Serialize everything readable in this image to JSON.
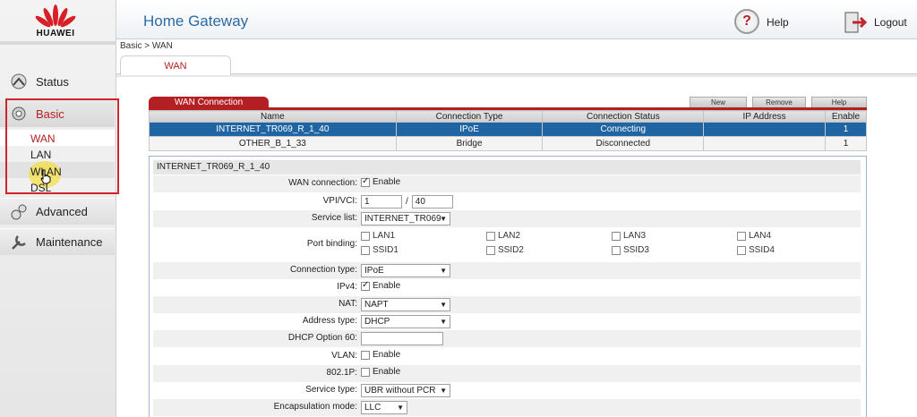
{
  "brand": {
    "name": "HUAWEI",
    "color": "#b41f24"
  },
  "header": {
    "title": "Home Gateway",
    "help_label": "Help",
    "logout_label": "Logout"
  },
  "breadcrumb": "Basic > WAN",
  "tab": {
    "label": "WAN"
  },
  "sidebar": {
    "items": [
      {
        "label": "Status",
        "icon": "status-icon"
      },
      {
        "label": "Basic",
        "icon": "basic-icon"
      },
      {
        "label": "Advanced",
        "icon": "advanced-icon"
      },
      {
        "label": "Maintenance",
        "icon": "maintenance-icon"
      }
    ],
    "basic_sub": [
      {
        "label": "WAN"
      },
      {
        "label": "LAN"
      },
      {
        "label": "WLAN"
      },
      {
        "label": "DSL"
      }
    ]
  },
  "wan_panel": {
    "tab_label": "WAN Connection",
    "buttons": {
      "new": "New",
      "remove": "Remove",
      "help": "Help"
    },
    "columns": [
      "Name",
      "Connection Type",
      "Connection Status",
      "IP Address",
      "Enable"
    ],
    "rows": [
      {
        "name": "INTERNET_TR069_R_1_40",
        "type": "IPoE",
        "status": "Connecting",
        "ip": "",
        "enable": "1"
      },
      {
        "name": "OTHER_B_1_33",
        "type": "Bridge",
        "status": "Disconnected",
        "ip": "",
        "enable": "1"
      }
    ]
  },
  "detail": {
    "title": "INTERNET_TR069_R_1_40",
    "wan_connection": {
      "label": "WAN connection:",
      "value": "Enable",
      "checked": true
    },
    "vpi_vci": {
      "label": "VPI/VCI:",
      "vpi": "1",
      "sep": "/",
      "vci": "40"
    },
    "service_list": {
      "label": "Service list:",
      "value": "INTERNET_TR069"
    },
    "port_binding": {
      "label": "Port binding:",
      "ports": [
        "LAN1",
        "LAN2",
        "LAN3",
        "LAN4",
        "SSID1",
        "SSID2",
        "SSID3",
        "SSID4"
      ]
    },
    "connection_type": {
      "label": "Connection type:",
      "value": "IPoE"
    },
    "ipv4": {
      "label": "IPv4:",
      "value": "Enable",
      "checked": true
    },
    "nat": {
      "label": "NAT:",
      "value": "NAPT"
    },
    "address_type": {
      "label": "Address type:",
      "value": "DHCP"
    },
    "dhcp_option60": {
      "label": "DHCP Option 60:",
      "value": ""
    },
    "vlan": {
      "label": "VLAN:",
      "value": "Enable",
      "checked": false
    },
    "dot1p": {
      "label": "802.1P:",
      "value": "Enable",
      "checked": false
    },
    "service_type": {
      "label": "Service type:",
      "value": "UBR without PCR"
    },
    "encapsulation": {
      "label": "Encapsulation mode:",
      "value": "LLC"
    }
  }
}
